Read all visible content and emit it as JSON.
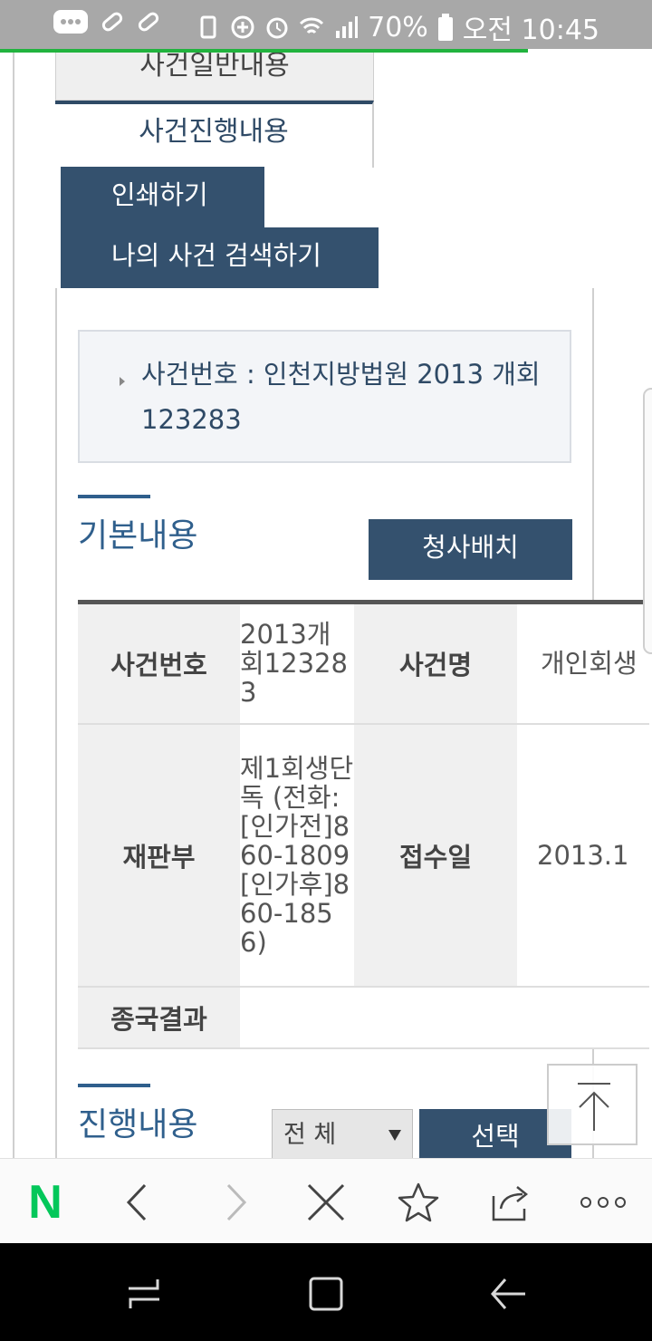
{
  "status_bar": {
    "battery": "70%",
    "time": "오전 10:45",
    "icons": [
      "message-icon",
      "pill-icon",
      "pill-icon",
      "battery-saver-icon",
      "data-saver-icon",
      "alarm-icon",
      "wifi-icon",
      "signal-icon",
      "battery-icon"
    ]
  },
  "page_load_progress": 0.81,
  "tabs": {
    "general": "사건일반내용",
    "progress": "사건진행내용"
  },
  "buttons": {
    "print": "인쇄하기",
    "my_case_search": "나의 사건 검색하기",
    "court_layout": "청사배치",
    "select": "선택"
  },
  "case_box": {
    "text": "사건번호 : 인천지방법원 2013 개회123283"
  },
  "sections": {
    "basic": "기본내용",
    "progress": "진행내용"
  },
  "info_table": {
    "row1": {
      "label1": "사건번호",
      "value1": "2013개회123283",
      "label2": "사건명",
      "value2": "개인회생"
    },
    "row2": {
      "label1": "재판부",
      "value1": "제1회생단독 (전화:[인가전]860-1809 [인가후]860-1856)",
      "label2": "접수일",
      "value2": "2013.1"
    },
    "row3": {
      "label1": "종국결과",
      "value1": ""
    }
  },
  "filter_select": {
    "value": "전 체"
  },
  "browser_toolbar": {
    "logo": "N",
    "icons": [
      "naver-logo-icon",
      "back-icon",
      "forward-icon",
      "close-icon",
      "bookmark-star-icon",
      "share-icon",
      "more-icon"
    ]
  },
  "colors": {
    "accent": "#34516e",
    "title": "#2f5f8c",
    "naver_green": "#03c75a"
  }
}
